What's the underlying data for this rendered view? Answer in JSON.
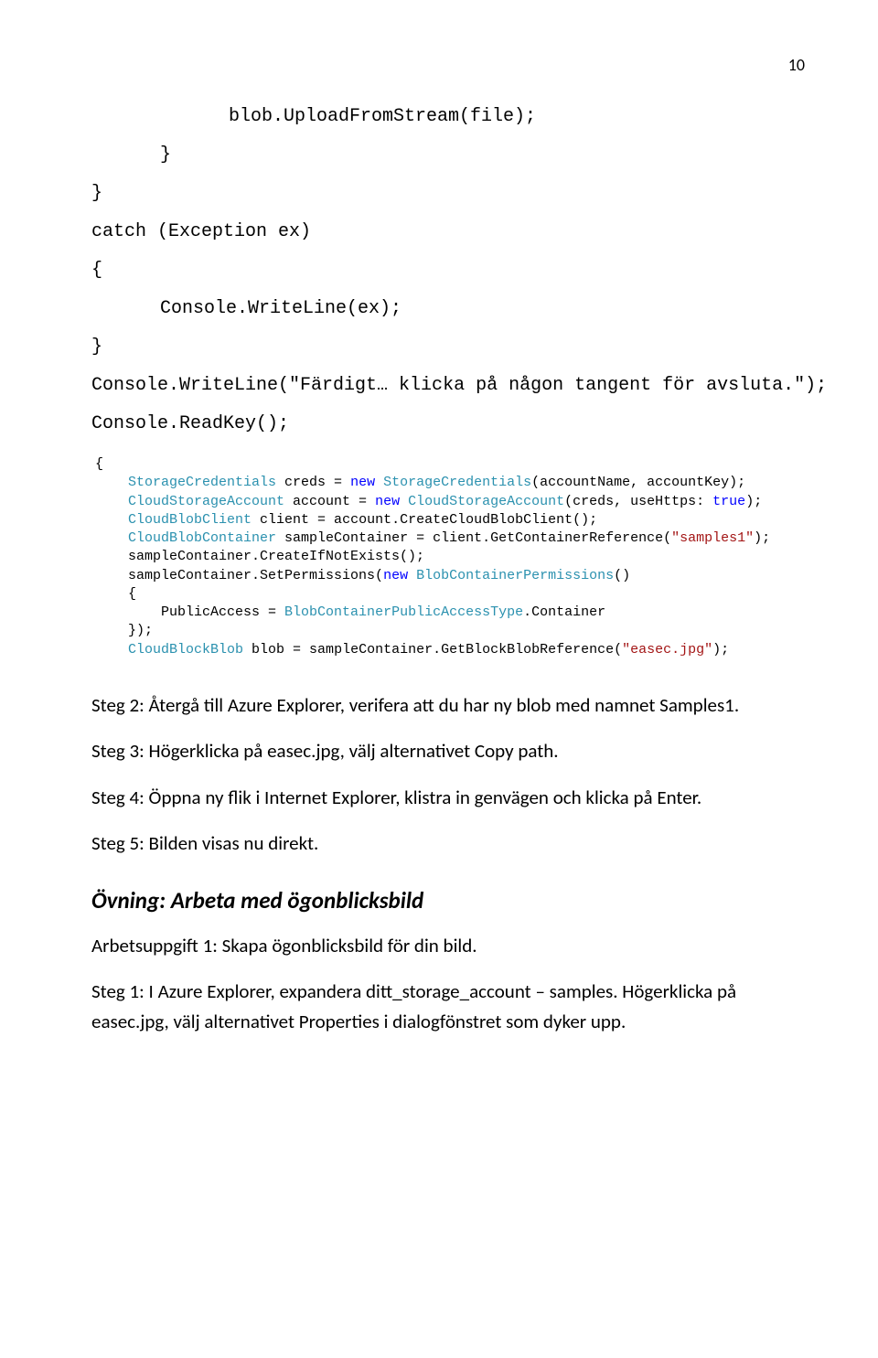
{
  "page_number": "10",
  "code": {
    "l1": "blob.UploadFromStream(file);",
    "l2": "}",
    "l3": "}",
    "l4": "catch (Exception ex)",
    "l5": "{",
    "l6": "Console.WriteLine(ex);",
    "l7": "}",
    "l8": "Console.WriteLine(\"Färdigt… klicka på någon tangent för avsluta.\");",
    "l9": "Console.ReadKey();"
  },
  "ide": {
    "brace_open": "{",
    "line1_pre": "    ",
    "line1_type1": "StorageCredentials",
    "line1_mid": " creds = ",
    "line1_kw": "new",
    "line1_sp": " ",
    "line1_type2": "StorageCredentials",
    "line1_tail": "(accountName, accountKey);",
    "line2_pre": "    ",
    "line2_type1": "CloudStorageAccount",
    "line2_mid": " account = ",
    "line2_kw": "new",
    "line2_sp": " ",
    "line2_type2": "CloudStorageAccount",
    "line2_tail1": "(creds, useHttps: ",
    "line2_kw2": "true",
    "line2_tail2": ");",
    "line3_pre": "    ",
    "line3_type": "CloudBlobClient",
    "line3_tail": " client = account.CreateCloudBlobClient();",
    "line4_pre": "    ",
    "line4_type": "CloudBlobContainer",
    "line4_mid": " sampleContainer = client.GetContainerReference(",
    "line4_str": "\"samples1\"",
    "line4_tail": ");",
    "line5": "    sampleContainer.CreateIfNotExists();",
    "line6_pre": "    sampleContainer.SetPermissions(",
    "line6_kw": "new",
    "line6_sp": " ",
    "line6_type": "BlobContainerPermissions",
    "line6_tail": "()",
    "line7": "    {",
    "line8_pre": "        PublicAccess = ",
    "line8_type": "BlobContainerPublicAccessType",
    "line8_tail": ".Container",
    "line9": "    });",
    "line10_pre": "    ",
    "line10_type": "CloudBlockBlob",
    "line10_mid": " blob = sampleContainer.GetBlockBlobReference(",
    "line10_str": "\"easec.jpg\"",
    "line10_tail": ");"
  },
  "steps": {
    "s2": "Steg 2: Återgå till Azure Explorer, verifera att du har ny blob med namnet Samples1.",
    "s3": "Steg 3: Högerklicka på easec.jpg, välj alternativet Copy path.",
    "s4": "Steg 4: Öppna ny flik i Internet Explorer, klistra in genvägen och klicka på Enter.",
    "s5": "Steg 5: Bilden visas nu direkt."
  },
  "exercise_heading": "Övning: Arbeta med ögonblicksbild",
  "task1": "Arbetsuppgift 1: Skapa ögonblicksbild för din bild.",
  "step1_after": "Steg 1: I Azure Explorer, expandera ditt_storage_account – samples. Högerklicka på easec.jpg, välj alternativet Properties i dialogfönstret som dyker upp."
}
